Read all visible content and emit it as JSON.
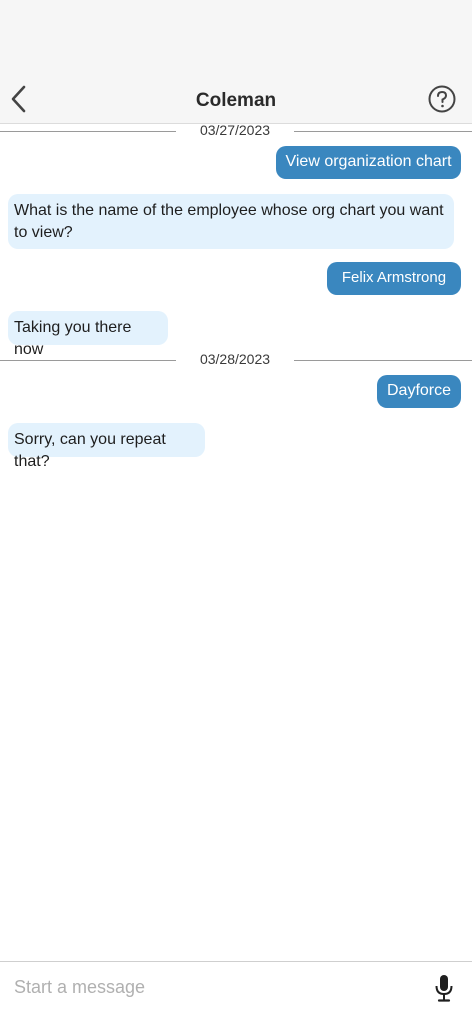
{
  "header": {
    "title": "Coleman",
    "back_icon": "chevron-left-icon",
    "help_icon": "help-circle-icon"
  },
  "colors": {
    "accent": "#3a87bf",
    "incoming_bubble": "#e3f2fd",
    "header_bg": "#f6f6f6"
  },
  "conversation": {
    "date_1": "03/27/2023",
    "date_2": "03/28/2023",
    "messages": [
      {
        "sender": "user",
        "text": "View organization chart"
      },
      {
        "sender": "bot",
        "text": "What is the name of the employee whose org chart you want to view?"
      },
      {
        "sender": "user",
        "text": "Felix Armstrong"
      },
      {
        "sender": "bot",
        "text": "Taking you there now"
      },
      {
        "sender": "user",
        "text": "Dayforce"
      },
      {
        "sender": "bot",
        "text": "Sorry, can you repeat that?"
      }
    ]
  },
  "composer": {
    "placeholder": "Start a message",
    "mic_icon": "microphone-icon"
  }
}
